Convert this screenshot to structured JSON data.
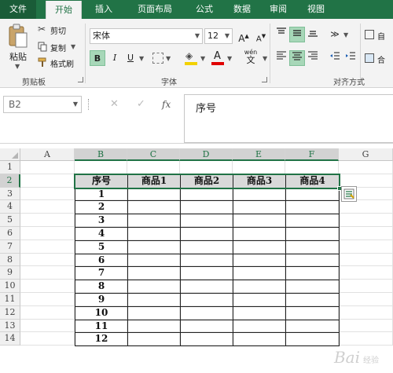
{
  "ribbon_tabs": [
    "文件",
    "开始",
    "插入",
    "页面布局",
    "公式",
    "数据",
    "审阅",
    "视图"
  ],
  "active_tab": "开始",
  "clipboard": {
    "paste_label": "粘贴",
    "cut_label": "剪切",
    "copy_label": "复制",
    "format_painter_label": "格式刷",
    "group_label": "剪贴板"
  },
  "font": {
    "name": "宋体",
    "size": "12",
    "grow_label": "A",
    "shrink_label": "A",
    "bold": "B",
    "italic": "I",
    "underline": "U",
    "font_color_letter": "A",
    "phonetic_label": "wén",
    "phonetic_char": "文",
    "group_label": "字体"
  },
  "alignment": {
    "group_label": "对齐方式",
    "wrap_label": "自",
    "merge_label": "合"
  },
  "formula_bar": {
    "name_box": "B2",
    "cancel_icon": "✕",
    "enter_icon": "✓",
    "fx_label": "fx",
    "content": "序号"
  },
  "sheet": {
    "columns": [
      "A",
      "B",
      "C",
      "D",
      "E",
      "F",
      "G"
    ],
    "rows": [
      "1",
      "2",
      "3",
      "4",
      "5",
      "6",
      "7",
      "8",
      "9",
      "10",
      "11",
      "12",
      "13",
      "14"
    ],
    "selected_cell": "B2",
    "table_header": [
      "序号",
      "商品1",
      "商品2",
      "商品3",
      "商品4"
    ],
    "table_rows": [
      [
        "1",
        "",
        "",
        "",
        ""
      ],
      [
        "2",
        "",
        "",
        "",
        ""
      ],
      [
        "3",
        "",
        "",
        "",
        ""
      ],
      [
        "4",
        "",
        "",
        "",
        ""
      ],
      [
        "5",
        "",
        "",
        "",
        ""
      ],
      [
        "6",
        "",
        "",
        "",
        ""
      ],
      [
        "7",
        "",
        "",
        "",
        ""
      ],
      [
        "8",
        "",
        "",
        "",
        ""
      ],
      [
        "9",
        "",
        "",
        "",
        ""
      ],
      [
        "10",
        "",
        "",
        "",
        ""
      ],
      [
        "11",
        "",
        "",
        "",
        ""
      ],
      [
        "12",
        "",
        "",
        "",
        ""
      ]
    ]
  },
  "watermark": {
    "text": "Bai",
    "sub": "经验"
  },
  "colors": {
    "accent": "#217346",
    "header_fill": "#d9d9d9",
    "highlight": "#a7d7b8"
  }
}
